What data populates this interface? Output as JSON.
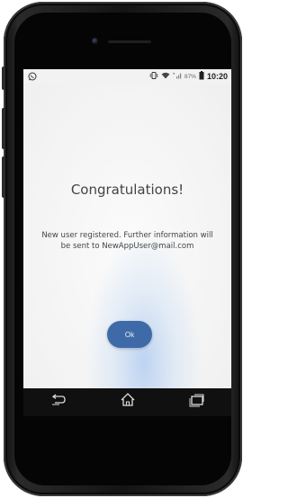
{
  "status_bar": {
    "left_icon": "whatsapp-icon",
    "vibrate_icon": "vibrate-icon",
    "wifi_icon": "wifi-icon",
    "signal_icon": "signal-icon",
    "battery_percent": "87%",
    "battery_icon": "battery-icon",
    "time": "10:20"
  },
  "dialog": {
    "title": "Congratulations!",
    "message": "New user registered. Further information will be sent to NewAppUser@mail.com",
    "ok_label": "Ok"
  },
  "nav_bar": {
    "back_icon": "back-icon",
    "home_icon": "home-icon",
    "recents_icon": "recents-icon"
  },
  "colors": {
    "accent": "#3e6ba8",
    "nav_background": "#101010",
    "screen_background": "#f7f7f7"
  }
}
